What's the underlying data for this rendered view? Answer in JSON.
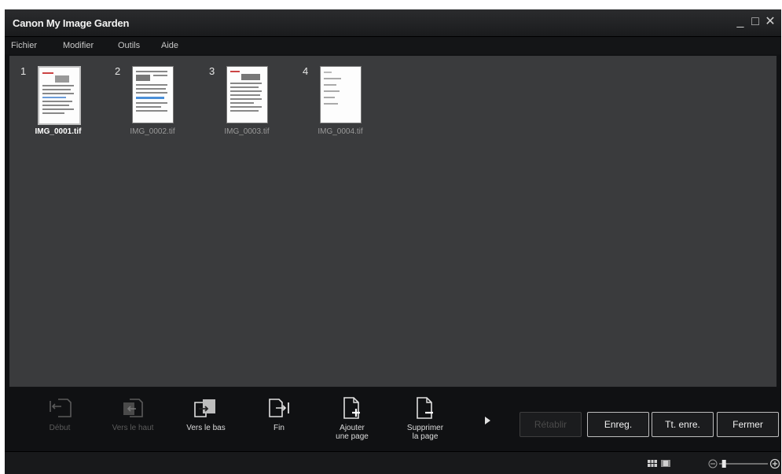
{
  "app": {
    "title": "Canon My Image Garden"
  },
  "window_controls": {
    "minimize": "_",
    "maximize": "□",
    "close": "✕"
  },
  "menu": {
    "items": [
      "Fichier",
      "Modifier",
      "Outils",
      "Aide"
    ]
  },
  "thumbnails": [
    {
      "number": "1",
      "filename": "IMG_0001.tif",
      "selected": true
    },
    {
      "number": "2",
      "filename": "IMG_0002.tif",
      "selected": false
    },
    {
      "number": "3",
      "filename": "IMG_0003.tif",
      "selected": false
    },
    {
      "number": "4",
      "filename": "IMG_0004.tif",
      "selected": false
    }
  ],
  "toolbar": {
    "tools": [
      {
        "label": "Début",
        "icon": "move-to-start-icon",
        "enabled": false
      },
      {
        "label": "Vers le haut",
        "icon": "move-up-icon",
        "enabled": false
      },
      {
        "label": "Vers le bas",
        "icon": "move-down-icon",
        "enabled": true
      },
      {
        "label": "Fin",
        "icon": "move-to-end-icon",
        "enabled": true
      },
      {
        "label": "Ajouter une page",
        "label_line1": "Ajouter",
        "label_line2": "une page",
        "icon": "add-page-icon",
        "enabled": true
      },
      {
        "label": "Supprimer la page",
        "label_line1": "Supprimer",
        "label_line2": "la page",
        "icon": "delete-page-icon",
        "enabled": true
      }
    ],
    "more_icon": "triangle-right-icon",
    "buttons": {
      "restore": {
        "label": "Rétablir",
        "enabled": false
      },
      "save": {
        "label": "Enreg.",
        "enabled": true
      },
      "save_all": {
        "label": "Tt. enre.",
        "enabled": true
      },
      "close": {
        "label": "Fermer",
        "enabled": true
      }
    }
  },
  "statusbar": {
    "view_icons": [
      "thumbnail-view-icon",
      "single-page-view-icon"
    ],
    "zoom": {
      "level_fraction": 0.1,
      "minus_icon": "zoom-out-icon",
      "plus_icon": "zoom-in-icon"
    }
  },
  "colors": {
    "window_bg": "#111214",
    "content_bg": "#3a3b3d",
    "text": "#f0f0f0",
    "disabled_text": "#5b5b5b"
  }
}
